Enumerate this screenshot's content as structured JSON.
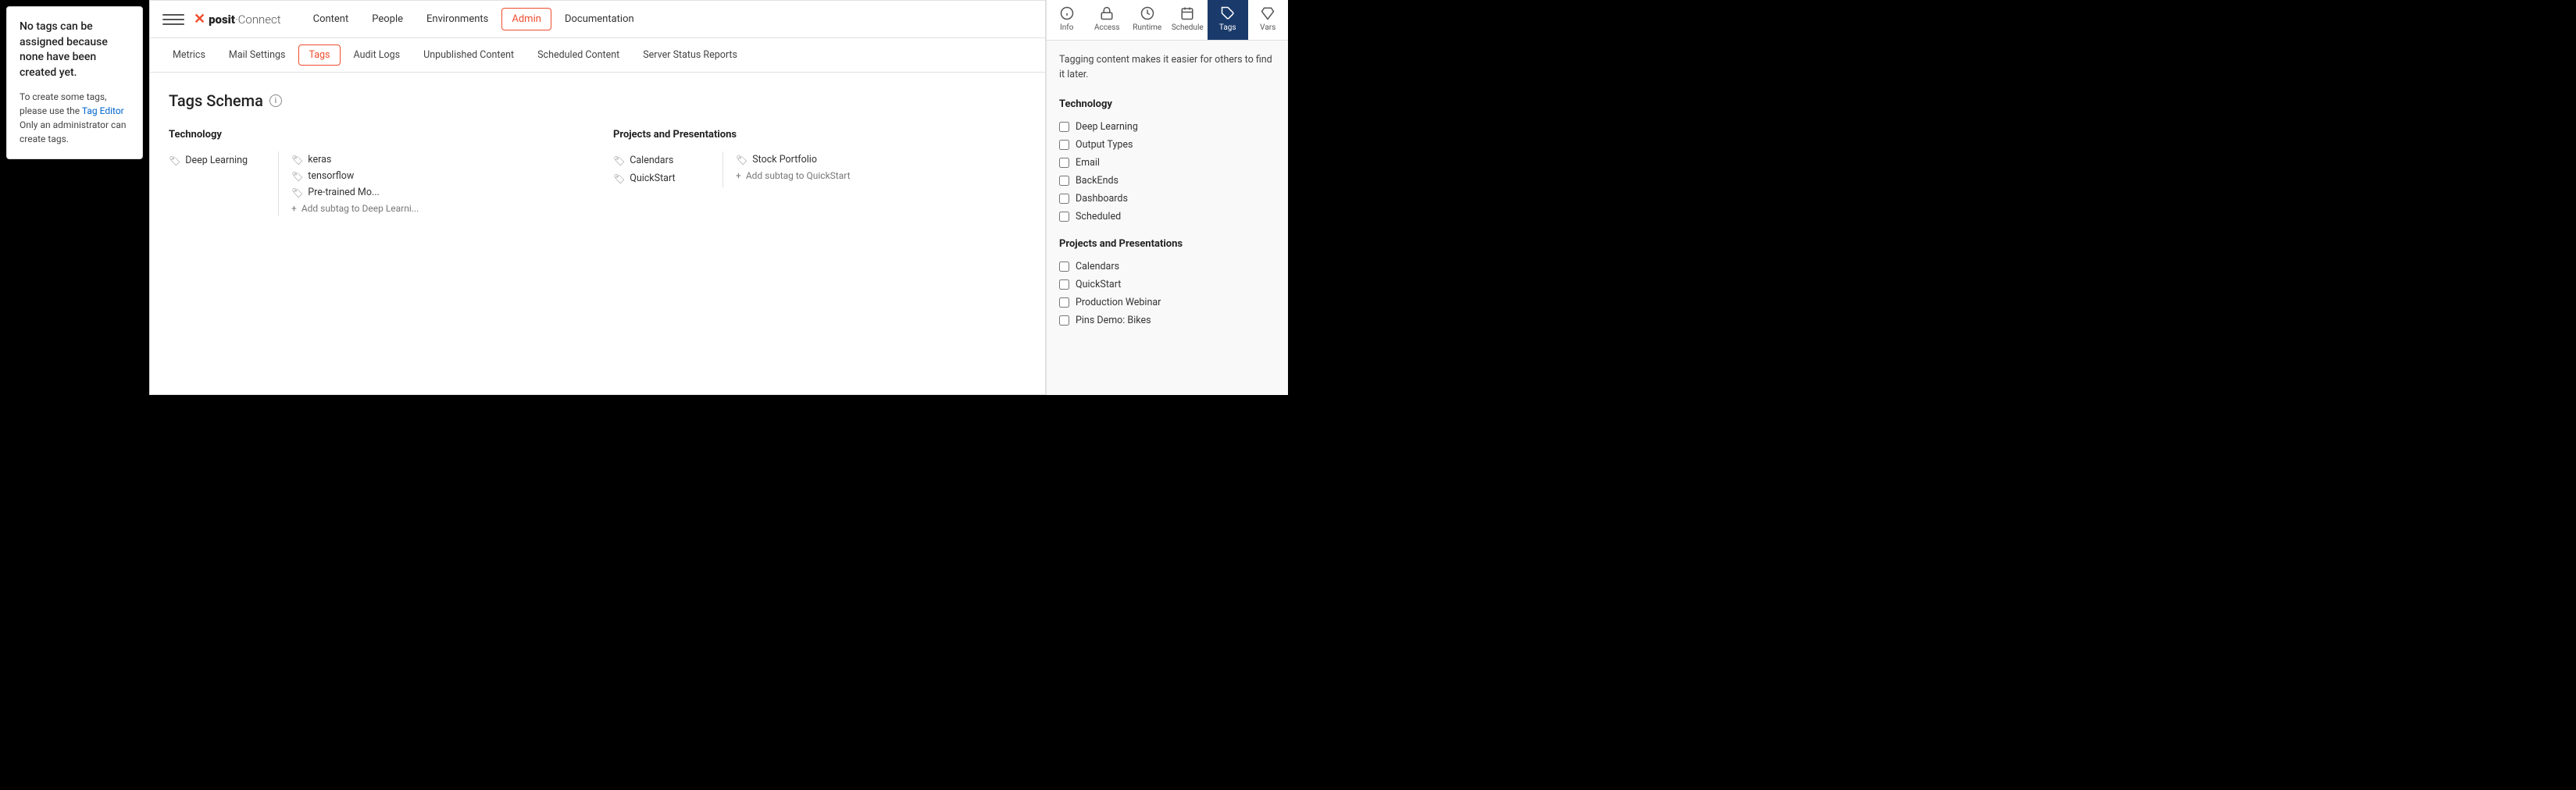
{
  "left_panel": {
    "title": "No tags can be assigned because none have been created yet.",
    "body": "To create some tags, please use the ",
    "link_text": "Tag Editor",
    "body2": " Only an administrator can create tags."
  },
  "navbar": {
    "logo_brand": "posit",
    "logo_product": "Connect",
    "nav_items": [
      {
        "label": "Content",
        "active": false
      },
      {
        "label": "People",
        "active": false
      },
      {
        "label": "Environments",
        "active": false
      },
      {
        "label": "Admin",
        "active": true
      },
      {
        "label": "Documentation",
        "active": false
      }
    ]
  },
  "sub_tabs": [
    {
      "label": "Metrics",
      "active": false
    },
    {
      "label": "Mail Settings",
      "active": false
    },
    {
      "label": "Tags",
      "active": true
    },
    {
      "label": "Audit Logs",
      "active": false
    },
    {
      "label": "Unpublished Content",
      "active": false
    },
    {
      "label": "Scheduled Content",
      "active": false
    },
    {
      "label": "Server Status Reports",
      "active": false
    }
  ],
  "page_title": "Tags Schema",
  "categories": [
    {
      "name": "Technology",
      "items": [
        {
          "label": "Deep Learning",
          "children": [
            "keras",
            "tensorflow",
            "Pre-trained Mo..."
          ],
          "add_subtag": "Add subtag to Deep Learni..."
        }
      ]
    },
    {
      "name": "Projects and Presentations",
      "items": [
        {
          "label": "Calendars",
          "children": []
        },
        {
          "label": "QuickStart",
          "children": [
            "Stock Portfolio"
          ],
          "add_subtag": "Add subtag to QuickStart"
        }
      ]
    }
  ],
  "right_panel": {
    "icons": [
      {
        "name": "Info",
        "label": "Info"
      },
      {
        "name": "Access",
        "label": "Access"
      },
      {
        "name": "Runtime",
        "label": "Runtime"
      },
      {
        "name": "Schedule",
        "label": "Schedule"
      },
      {
        "name": "Tags",
        "label": "Tags",
        "active": true
      },
      {
        "name": "Vars",
        "label": "Vars"
      }
    ],
    "intro": "Tagging content makes it easier for others to find it later.",
    "sections": [
      {
        "title": "Technology",
        "checkboxes": [
          "Deep Learning",
          "Output Types",
          "Email",
          "BackEnds",
          "Dashboards",
          "Scheduled"
        ]
      },
      {
        "title": "Projects and Presentations",
        "checkboxes": [
          "Calendars",
          "QuickStart",
          "Production Webinar",
          "Pins Demo: Bikes"
        ]
      }
    ]
  }
}
